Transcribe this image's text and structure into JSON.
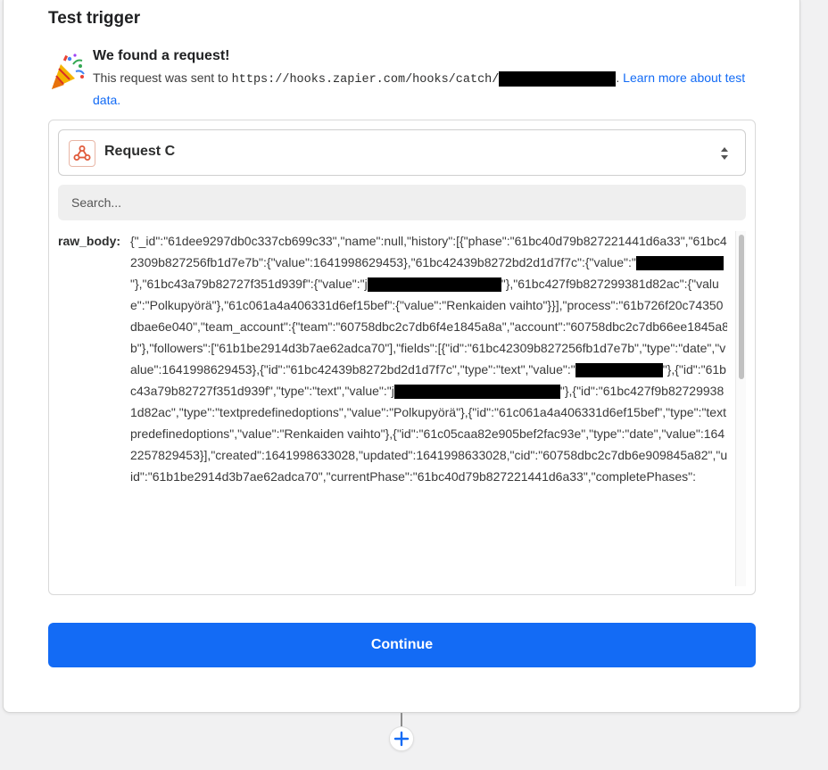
{
  "section_title": "Test trigger",
  "found": {
    "title": "We found a request!",
    "prefix": "This request was sent to",
    "url": "https://hooks.zapier.com/hooks/catch/",
    "link_text": "Learn more about test data."
  },
  "request_select": {
    "label": "Request C",
    "app_icon": "webhook-icon"
  },
  "search": {
    "placeholder": "Search..."
  },
  "raw_body": {
    "key": "raw_body:",
    "segments": [
      "{\"_id\":\"61dee9297db0c337cb699c33\",\"name\":null,\"history\":[{\"phase\":\"61bc40d79b827221441d6a33\",\"61bc42309b827256fb1d7e7b\":{\"value\":1641998629453},\"61bc42439b8272bd2d1d7f7c\":{\"value\":\"",
      "\"},\"61bc43a79b82727f351d939f\":{\"value\":\"j",
      "\"},\"61bc427f9b827299381d82ac\":{\"value\":\"Polkupyörä\"},\"61c061a4a406331d6ef15bef\":{\"value\":\"Renkaiden vaihto\"}}],\"process\":\"61b726f20c74350dbae6e040\",\"team_account\":{\"team\":\"60758dbc2c7db6f4e1845a8a\",\"account\":\"60758dbc2c7db66ee1845a8b\"},\"followers\":[\"61b1be2914d3b7ae62adca70\"],\"fields\":[{\"id\":\"61bc42309b827256fb1d7e7b\",\"type\":\"date\",\"value\":1641998629453},{\"id\":\"61bc42439b8272bd2d1d7f7c\",\"type\":\"text\",\"value\":\"",
      "\"},{\"id\":\"61bc43a79b82727f351d939f\",\"type\":\"text\",\"value\":\"j",
      "\"},{\"id\":\"61bc427f9b827299381d82ac\",\"type\":\"textpredefinedoptions\",\"value\":\"Polkupyörä\"},{\"id\":\"61c061a4a406331d6ef15bef\",\"type\":\"textpredefinedoptions\",\"value\":\"Renkaiden vaihto\"},{\"id\":\"61c05caa82e905bef2fac93e\",\"type\":\"date\",\"value\":1642257829453}],\"created\":1641998633028,\"updated\":1641998633028,\"cid\":\"60758dbc2c7db6e909845a82\",\"uid\":\"61b1be2914d3b7ae62adca70\",\"currentPhase\":\"61bc40d79b827221441d6a33\",\"completePhases\":"
    ]
  },
  "continue_button": {
    "label": "Continue"
  },
  "colors": {
    "accent": "#136bf5",
    "redaction": "#000000"
  }
}
